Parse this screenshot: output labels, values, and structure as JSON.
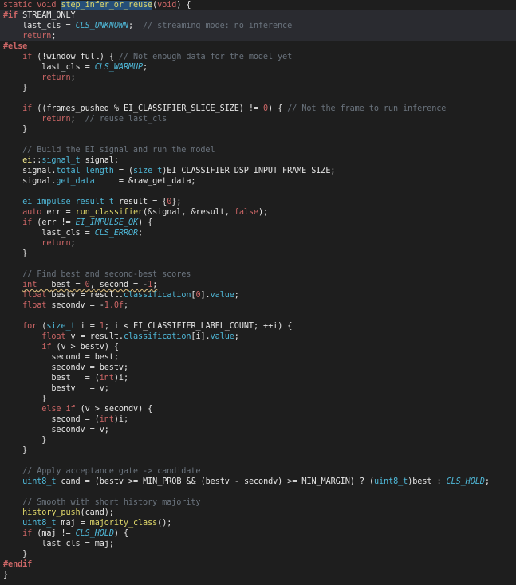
{
  "editor": {
    "language": "C++",
    "lines": [
      "static void step_infer_or_reuse(void) {",
      "#if STREAM_ONLY",
      "    last_cls = CLS_UNKNOWN;  // streaming mode: no inference",
      "    return;",
      "#else",
      "    if (!window_full) { // Not enough data for the model yet",
      "        last_cls = CLS_WARMUP;",
      "        return;",
      "    }",
      "",
      "    if ((frames_pushed % EI_CLASSIFIER_SLICE_SIZE) != 0) { // Not the frame to run inference",
      "        return;  // reuse last_cls",
      "    }",
      "",
      "    // Build the EI signal and run the model",
      "    ei::signal_t signal;",
      "    signal.total_length = (size_t)EI_CLASSIFIER_DSP_INPUT_FRAME_SIZE;",
      "    signal.get_data     = &raw_get_data;",
      "",
      "    ei_impulse_result_t result = {0};",
      "    auto err = run_classifier(&signal, &result, false);",
      "    if (err != EI_IMPULSE_OK) {",
      "        last_cls = CLS_ERROR;",
      "        return;",
      "    }",
      "",
      "    // Find best and second-best scores",
      "    int   best = 0, second = -1;",
      "    float bestv = result.classification[0].value;",
      "    float secondv = -1.0f;",
      "",
      "    for (size_t i = 1; i < EI_CLASSIFIER_LABEL_COUNT; ++i) {",
      "        float v = result.classification[i].value;",
      "        if (v > bestv) {",
      "          second = best;",
      "          secondv = bestv;",
      "          best   = (int)i;",
      "          bestv   = v;",
      "        }",
      "        else if (v > secondv) {",
      "          second = (int)i;",
      "          secondv = v;",
      "        }",
      "    }",
      "",
      "    // Apply acceptance gate -> candidate",
      "    uint8_t cand = (bestv >= MIN_PROB && (bestv - secondv) >= MIN_MARGIN) ? (uint8_t)best : CLS_HOLD;",
      "",
      "    // Smooth with short history majority",
      "    history_push(cand);",
      "    uint8_t maj = majority_class();",
      "    if (maj != CLS_HOLD) {",
      "        last_cls = maj;",
      "    }",
      "#endif",
      "}"
    ]
  }
}
